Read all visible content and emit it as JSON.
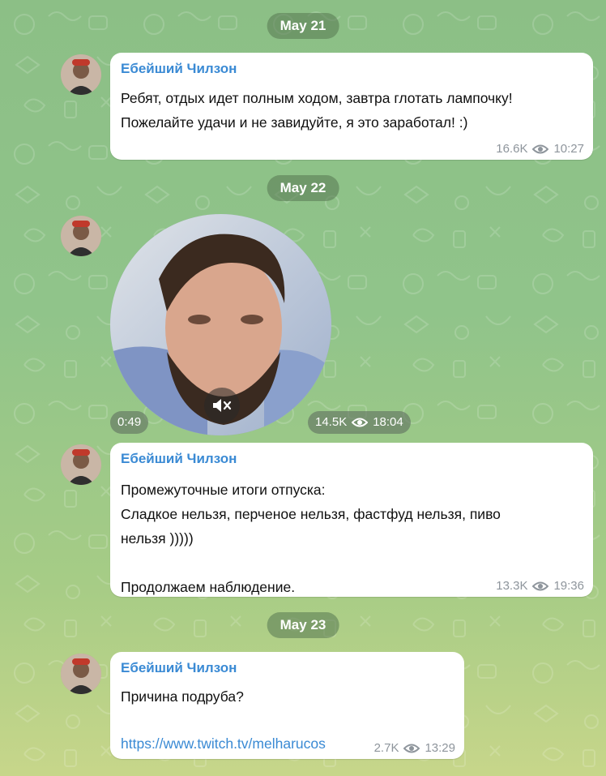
{
  "dates": [
    "May 21",
    "May 22",
    "May 23"
  ],
  "messages": [
    {
      "sender": "Ебейший Чилзон",
      "text": "Ребят, отдых идет полным ходом, завтра глотать лампочку!\nПожелайте удачи и не завидуйте, я это заработал! :)",
      "views": "16.6K",
      "time": "10:27"
    },
    {
      "type": "video-note",
      "duration": "0:49",
      "views": "14.5K",
      "time": "18:04",
      "muted": true
    },
    {
      "sender": "Ебейший Чилзон",
      "text": "Промежуточные итоги отпуска:\nСладкое нельзя, перченое нельзя, фастфуд нельзя, пиво\nнельзя )))))\n\nПродолжаем наблюдение.",
      "views": "13.3K",
      "time": "19:36"
    },
    {
      "sender": "Ебейший Чилзон",
      "text": "Причина подруба?",
      "link": "https://www.twitch.tv/melharucos",
      "views": "2.7K",
      "time": "13:29"
    }
  ],
  "icons": {
    "views": "eye-icon",
    "mute": "speaker-muted-icon",
    "avatar": "channel-avatar"
  },
  "colors": {
    "link": "#3a8ad4",
    "sender": "#3a8ad4",
    "meta": "#8e959c"
  }
}
